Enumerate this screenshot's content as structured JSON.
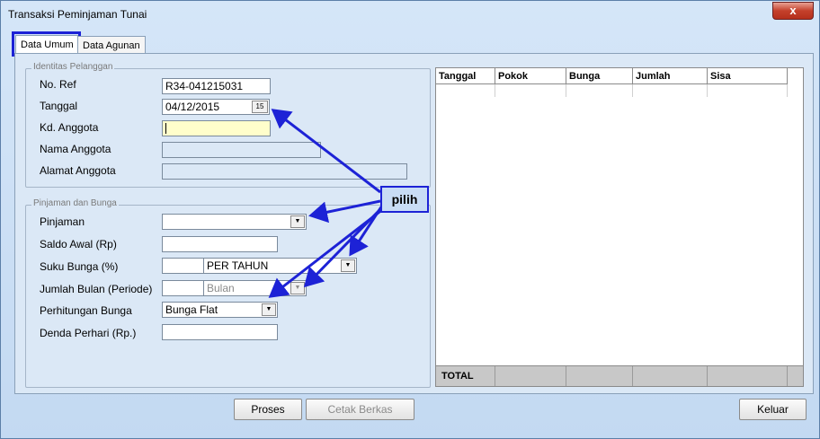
{
  "window": {
    "title": "Transaksi Peminjaman Tunai",
    "close_glyph": "x"
  },
  "tabs": [
    {
      "label": "Data Umum"
    },
    {
      "label": "Data Agunan"
    }
  ],
  "identitas": {
    "group_title": "Identitas Pelanggan",
    "no_ref_label": "No. Ref",
    "no_ref_value": "R34-041215031",
    "tanggal_label": "Tanggal",
    "tanggal_value": "04/12/2015",
    "calendar_glyph": "15",
    "kd_anggota_label": "Kd. Anggota",
    "kd_anggota_value": "",
    "nama_anggota_label": "Nama Anggota",
    "nama_anggota_value": "",
    "alamat_anggota_label": "Alamat Anggota",
    "alamat_anggota_value": ""
  },
  "pinjaman": {
    "group_title": "Pinjaman dan Bunga",
    "pinjaman_label": "Pinjaman",
    "pinjaman_value": "",
    "saldo_awal_label": "Saldo Awal (Rp)",
    "saldo_awal_value": "",
    "suku_bunga_label": "Suku Bunga (%)",
    "suku_bunga_value": "",
    "suku_bunga_period": "PER TAHUN",
    "jumlah_bulan_label": "Jumlah Bulan (Periode)",
    "jumlah_bulan_value": "",
    "jumlah_bulan_unit": "Bulan",
    "perhitungan_label": "Perhitungan Bunga",
    "perhitungan_value": "Bunga Flat",
    "denda_label": "Denda Perhari (Rp.)",
    "denda_value": ""
  },
  "grid": {
    "columns": [
      "Tanggal",
      "Pokok",
      "Bunga",
      "Jumlah",
      "Sisa"
    ],
    "footer_label": "TOTAL"
  },
  "buttons": {
    "proses": "Proses",
    "cetak": "Cetak Berkas",
    "keluar": "Keluar"
  },
  "callout": {
    "text": "pilih"
  },
  "colors": {
    "annotation_blue": "#1d22d6",
    "input_highlight": "#fffecb"
  }
}
